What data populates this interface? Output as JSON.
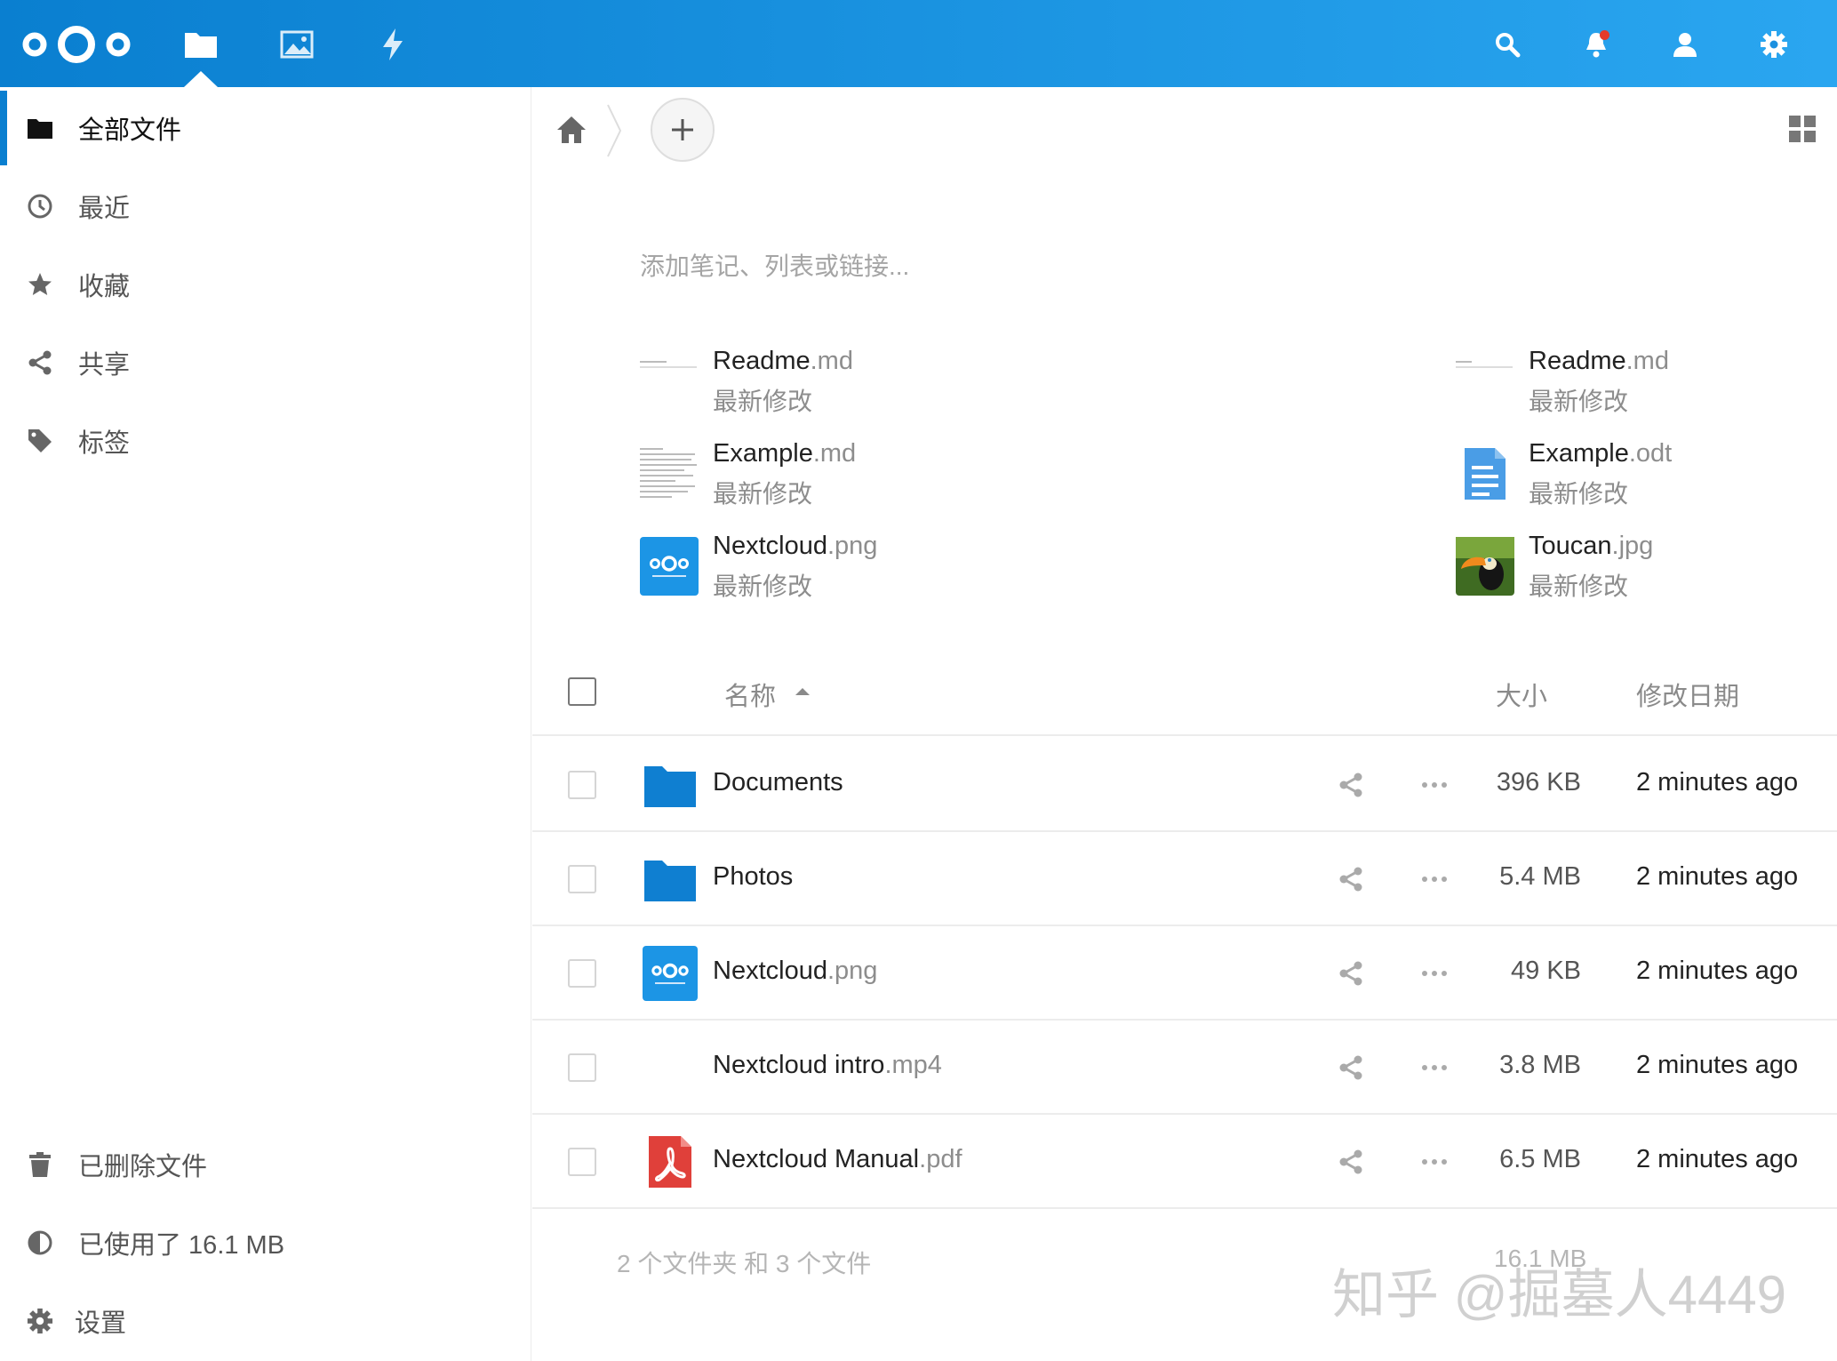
{
  "header": {
    "apps": [
      {
        "name": "files-icon",
        "active": true
      },
      {
        "name": "photos-icon",
        "active": false
      },
      {
        "name": "activity-icon",
        "active": false
      }
    ],
    "accent": "#0a7fd0"
  },
  "sidebar": {
    "items": [
      {
        "label": "全部文件",
        "icon": "folder-icon",
        "active": true
      },
      {
        "label": "最近",
        "icon": "clock-icon"
      },
      {
        "label": "收藏",
        "icon": "star-icon"
      },
      {
        "label": "共享",
        "icon": "share-icon"
      },
      {
        "label": "标签",
        "icon": "tag-icon"
      }
    ],
    "bottom": {
      "trash_label": "已删除文件",
      "quota_label": "已使用了 16.1 MB",
      "settings_label": "设置"
    }
  },
  "main": {
    "rich_workspace_placeholder": "添加笔记、列表或链接...",
    "recent": [
      {
        "base": "Readme",
        "ext": ".md",
        "sub": "最新修改",
        "thumb": "markdown-thumb"
      },
      {
        "base": "Readme",
        "ext": ".md",
        "sub": "最新修改",
        "thumb": "markdown-thumb"
      },
      {
        "base": "Example",
        "ext": ".md",
        "sub": "最新修改",
        "thumb": "markdown-thumb"
      },
      {
        "base": "Example",
        "ext": ".odt",
        "sub": "最新修改",
        "thumb": "document-icon"
      },
      {
        "base": "Nextcloud",
        "ext": ".png",
        "sub": "最新修改",
        "thumb": "nextcloud-thumb"
      },
      {
        "base": "Toucan",
        "ext": ".jpg",
        "sub": "最新修改",
        "thumb": "toucan-thumb"
      }
    ],
    "table": {
      "col_name": "名称",
      "col_size": "大小",
      "col_date": "修改日期",
      "rows": [
        {
          "base": "Documents",
          "ext": "",
          "size": "396 KB",
          "date": "2 minutes ago",
          "icon": "folder-icon"
        },
        {
          "base": "Photos",
          "ext": "",
          "size": "5.4 MB",
          "date": "2 minutes ago",
          "icon": "folder-icon"
        },
        {
          "base": "Nextcloud",
          "ext": ".png",
          "size": "49 KB",
          "date": "2 minutes ago",
          "icon": "nextcloud-thumb"
        },
        {
          "base": "Nextcloud intro",
          "ext": ".mp4",
          "size": "3.8 MB",
          "date": "2 minutes ago",
          "icon": "video-icon"
        },
        {
          "base": "Nextcloud Manual",
          "ext": ".pdf",
          "size": "6.5 MB",
          "date": "2 minutes ago",
          "icon": "pdf-icon"
        }
      ],
      "summary": "2 个文件夹 和 3 个文件",
      "summary_size": "16.1 MB"
    }
  },
  "watermark": "知乎 @掘墓人4449"
}
